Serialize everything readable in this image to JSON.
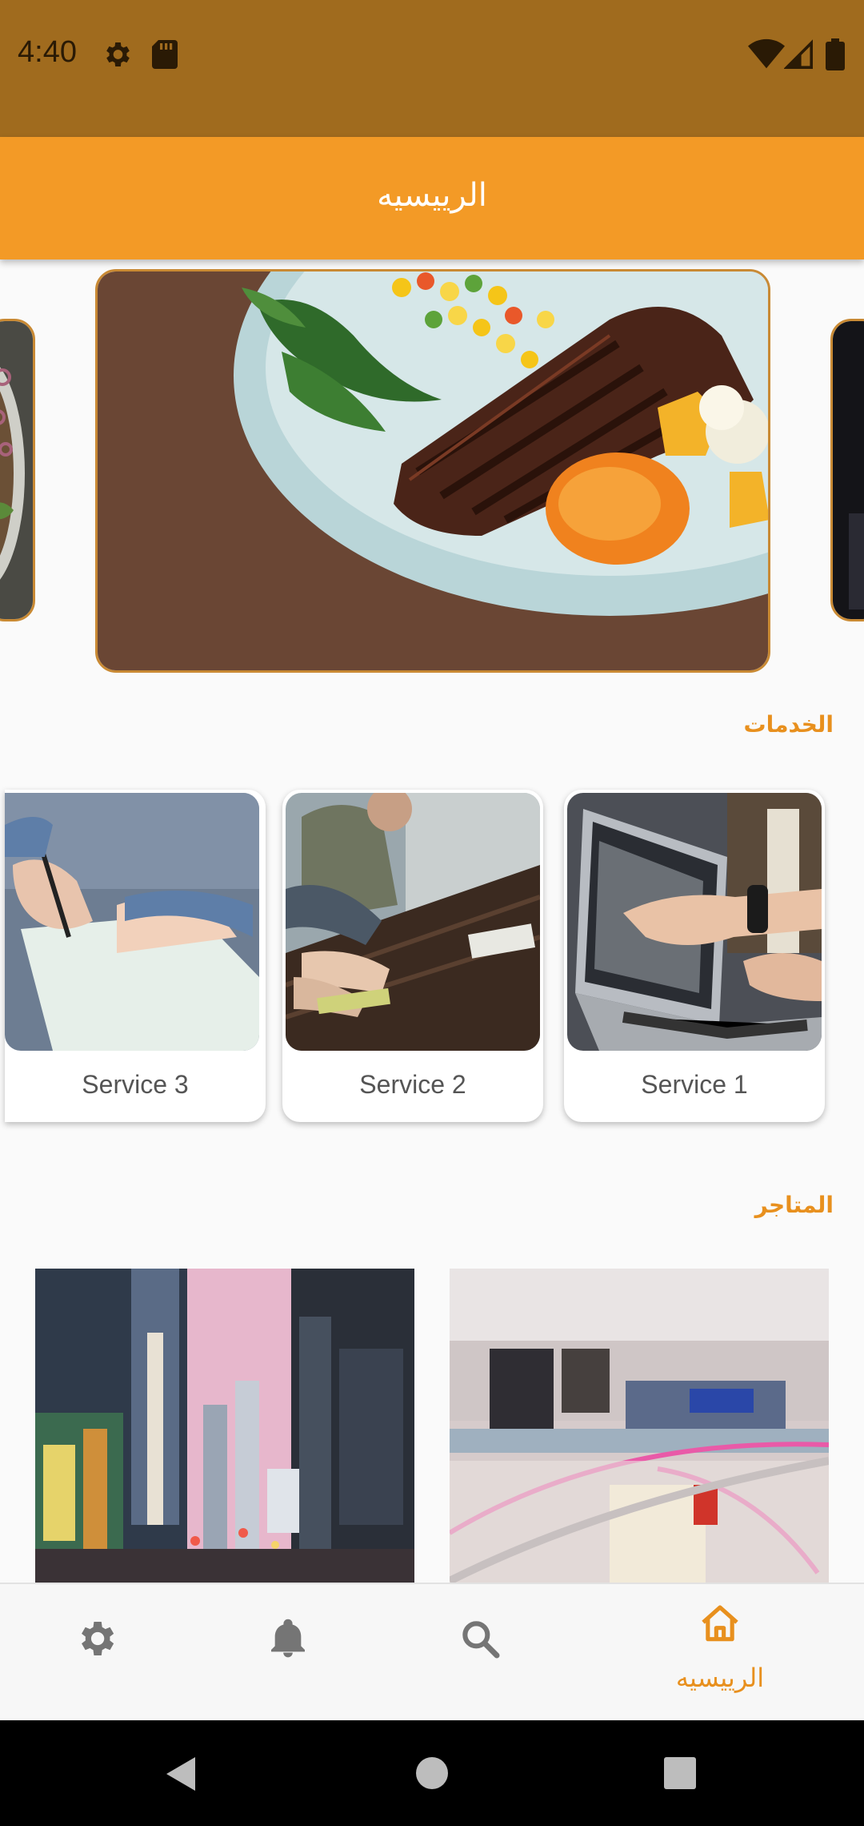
{
  "status_bar": {
    "time": "4:40"
  },
  "app_bar": {
    "title": "الرييسيه"
  },
  "sections": {
    "services_title": "الخدمات",
    "stores_title": "المتاجر"
  },
  "services": [
    {
      "label": "Service 3"
    },
    {
      "label": "Service 2"
    },
    {
      "label": "Service 1"
    }
  ],
  "bottom_nav": {
    "home_label": "الرييسيه"
  },
  "colors": {
    "accent": "#f39a26",
    "status_bar": "#a06b1e",
    "nav_active": "#e8901e"
  }
}
